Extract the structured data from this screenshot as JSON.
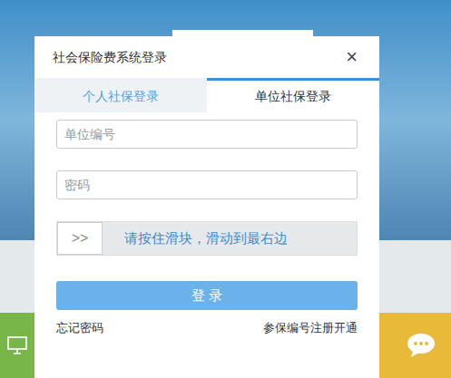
{
  "window": {
    "title": "社会保险费系统登录",
    "close": "×"
  },
  "tabs": [
    {
      "label": "个人社保登录",
      "selected": false
    },
    {
      "label": "单位社保登录",
      "selected": true
    }
  ],
  "fields": [
    {
      "placeholder": "单位编号",
      "kind": "text"
    },
    {
      "placeholder": "密码",
      "kind": "password"
    }
  ],
  "slider": {
    "handle": ">>",
    "hint": "请按住滑块，滑动到最右边",
    "level": 0
  },
  "button": "登 录",
  "links": [
    "忘记密码",
    "参保编号注册开通"
  ]
}
